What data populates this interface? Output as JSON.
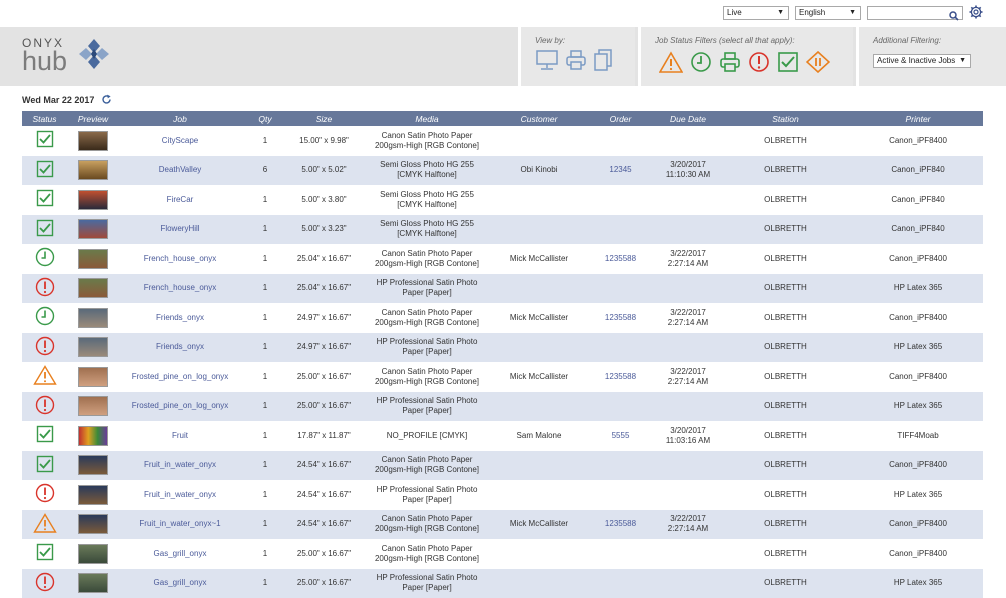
{
  "topbar": {
    "mode_select": "Live",
    "language_select": "English",
    "search_value": ""
  },
  "logo": {
    "word_top": "ONYX",
    "word_bottom": "hub"
  },
  "view_by": {
    "label": "View by:"
  },
  "status_filters": {
    "label": "Job Status Filters (select all that apply):"
  },
  "additional_filtering": {
    "label": "Additional Filtering:",
    "selected": "Active & Inactive Jobs"
  },
  "date": "Wed Mar 22 2017",
  "columns": [
    "Status",
    "Preview",
    "Job",
    "Qty",
    "Size",
    "Media",
    "Customer",
    "Order",
    "Due Date",
    "Station",
    "Printer"
  ],
  "colors": {
    "header_bg": "#67789a",
    "alt_row": "#dde3ef",
    "status_ok": "#3a9a4a",
    "status_error": "#d9342b",
    "status_warning": "#e8801f",
    "link": "#4a5a99"
  },
  "rows": [
    {
      "status": "complete",
      "preview": "thumb-cityscape",
      "job": "CityScape",
      "qty": "1",
      "size": "15.00\" x 9.98\"",
      "media1": "Canon Satin Photo Paper",
      "media2": "200gsm-High [RGB Contone]",
      "customer": "",
      "order": "",
      "due1": "",
      "due2": "",
      "station": "OLBRETTH",
      "printer": "Canon_iPF8400"
    },
    {
      "status": "complete",
      "preview": "thumb-deathvalley",
      "job": "DeathValley",
      "qty": "6",
      "size": "5.00\" x 5.02\"",
      "media1": "Semi Gloss Photo HG 255",
      "media2": "[CMYK Halftone]",
      "customer": "Obi Kinobi",
      "order": "12345",
      "due1": "3/20/2017",
      "due2": "11:10:30 AM",
      "station": "OLBRETTH",
      "printer": "Canon_iPF840"
    },
    {
      "status": "complete",
      "preview": "thumb-firecar",
      "job": "FireCar",
      "qty": "1",
      "size": "5.00\" x 3.80\"",
      "media1": "Semi Gloss Photo HG 255",
      "media2": "[CMYK Halftone]",
      "customer": "",
      "order": "",
      "due1": "",
      "due2": "",
      "station": "OLBRETTH",
      "printer": "Canon_iPF840"
    },
    {
      "status": "complete",
      "preview": "thumb-floweryhill",
      "job": "FloweryHill",
      "qty": "1",
      "size": "5.00\" x 3.23\"",
      "media1": "Semi Gloss Photo HG 255",
      "media2": "[CMYK Halftone]",
      "customer": "",
      "order": "",
      "due1": "",
      "due2": "",
      "station": "OLBRETTH",
      "printer": "Canon_iPF840"
    },
    {
      "status": "pending",
      "preview": "thumb-french-house",
      "job": "French_house_onyx",
      "qty": "1",
      "size": "25.04\" x 16.67\"",
      "media1": "Canon Satin Photo Paper",
      "media2": "200gsm-High [RGB Contone]",
      "customer": "Mick McCallister",
      "order": "1235588",
      "due1": "3/22/2017",
      "due2": "2:27:14 AM",
      "station": "OLBRETTH",
      "printer": "Canon_iPF8400"
    },
    {
      "status": "error",
      "preview": "thumb-french-house",
      "job": "French_house_onyx",
      "qty": "1",
      "size": "25.04\" x 16.67\"",
      "media1": "HP Professional Satin Photo",
      "media2": "Paper [Paper]",
      "customer": "",
      "order": "",
      "due1": "",
      "due2": "",
      "station": "OLBRETTH",
      "printer": "HP Latex 365"
    },
    {
      "status": "pending",
      "preview": "thumb-friends",
      "job": "Friends_onyx",
      "qty": "1",
      "size": "24.97\" x 16.67\"",
      "media1": "Canon Satin Photo Paper",
      "media2": "200gsm-High [RGB Contone]",
      "customer": "Mick McCallister",
      "order": "1235588",
      "due1": "3/22/2017",
      "due2": "2:27:14 AM",
      "station": "OLBRETTH",
      "printer": "Canon_iPF8400"
    },
    {
      "status": "error",
      "preview": "thumb-friends",
      "job": "Friends_onyx",
      "qty": "1",
      "size": "24.97\" x 16.67\"",
      "media1": "HP Professional Satin Photo",
      "media2": "Paper [Paper]",
      "customer": "",
      "order": "",
      "due1": "",
      "due2": "",
      "station": "OLBRETTH",
      "printer": "HP Latex 365"
    },
    {
      "status": "warning",
      "preview": "thumb-frosted-pine",
      "job": "Frosted_pine_on_log_onyx",
      "qty": "1",
      "size": "25.00\" x 16.67\"",
      "media1": "Canon Satin Photo Paper",
      "media2": "200gsm-High [RGB Contone]",
      "customer": "Mick McCallister",
      "order": "1235588",
      "due1": "3/22/2017",
      "due2": "2:27:14 AM",
      "station": "OLBRETTH",
      "printer": "Canon_iPF8400"
    },
    {
      "status": "error",
      "preview": "thumb-frosted-pine",
      "job": "Frosted_pine_on_log_onyx",
      "qty": "1",
      "size": "25.00\" x 16.67\"",
      "media1": "HP Professional Satin Photo",
      "media2": "Paper [Paper]",
      "customer": "",
      "order": "",
      "due1": "",
      "due2": "",
      "station": "OLBRETTH",
      "printer": "HP Latex 365"
    },
    {
      "status": "complete",
      "preview": "thumb-fruit",
      "job": "Fruit",
      "qty": "1",
      "size": "17.87\" x 11.87\"",
      "media1": "NO_PROFILE [CMYK]",
      "media2": "",
      "customer": "Sam Malone",
      "order": "5555",
      "due1": "3/20/2017",
      "due2": "11:03:16 AM",
      "station": "OLBRETTH",
      "printer": "TIFF4Moab"
    },
    {
      "status": "complete",
      "preview": "thumb-fruit-water",
      "job": "Fruit_in_water_onyx",
      "qty": "1",
      "size": "24.54\" x 16.67\"",
      "media1": "Canon Satin Photo Paper",
      "media2": "200gsm-High [RGB Contone]",
      "customer": "",
      "order": "",
      "due1": "",
      "due2": "",
      "station": "OLBRETTH",
      "printer": "Canon_iPF8400"
    },
    {
      "status": "error",
      "preview": "thumb-fruit-water",
      "job": "Fruit_in_water_onyx",
      "qty": "1",
      "size": "24.54\" x 16.67\"",
      "media1": "HP Professional Satin Photo",
      "media2": "Paper [Paper]",
      "customer": "",
      "order": "",
      "due1": "",
      "due2": "",
      "station": "OLBRETTH",
      "printer": "HP Latex 365"
    },
    {
      "status": "warning",
      "preview": "thumb-fruit-water",
      "job": "Fruit_in_water_onyx~1",
      "qty": "1",
      "size": "24.54\" x 16.67\"",
      "media1": "Canon Satin Photo Paper",
      "media2": "200gsm-High [RGB Contone]",
      "customer": "Mick McCallister",
      "order": "1235588",
      "due1": "3/22/2017",
      "due2": "2:27:14 AM",
      "station": "OLBRETTH",
      "printer": "Canon_iPF8400"
    },
    {
      "status": "complete",
      "preview": "thumb-gas-grill",
      "job": "Gas_grill_onyx",
      "qty": "1",
      "size": "25.00\" x 16.67\"",
      "media1": "Canon Satin Photo Paper",
      "media2": "200gsm-High [RGB Contone]",
      "customer": "",
      "order": "",
      "due1": "",
      "due2": "",
      "station": "OLBRETTH",
      "printer": "Canon_iPF8400"
    },
    {
      "status": "error",
      "preview": "thumb-gas-grill",
      "job": "Gas_grill_onyx",
      "qty": "1",
      "size": "25.00\" x 16.67\"",
      "media1": "HP Professional Satin Photo",
      "media2": "Paper [Paper]",
      "customer": "",
      "order": "",
      "due1": "",
      "due2": "",
      "station": "OLBRETTH",
      "printer": "HP Latex 365"
    }
  ]
}
